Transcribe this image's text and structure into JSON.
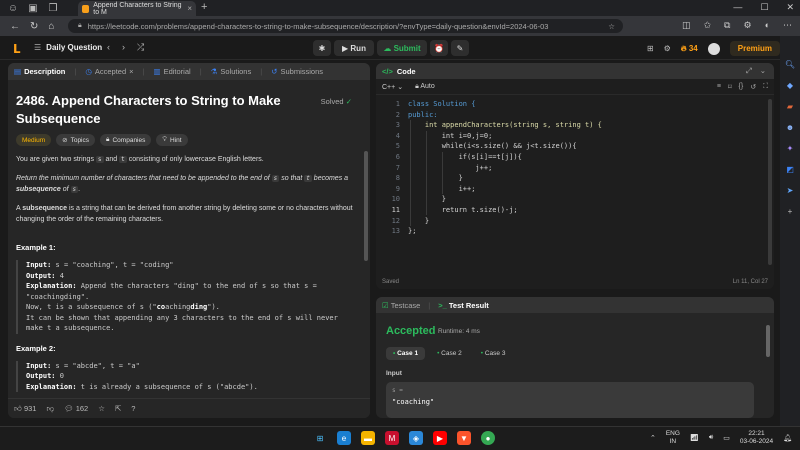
{
  "browser": {
    "tab_title": "Append Characters to String to M",
    "url": "https://leetcode.com/problems/append-characters-to-string-to-make-subsequence/description/?envType=daily-question&envId=2024-06-03"
  },
  "header": {
    "daily_question": "Daily Question",
    "run": "Run",
    "submit": "Submit",
    "streak": "34",
    "premium": "Premium"
  },
  "left": {
    "tabs": [
      {
        "label": "Description",
        "icon": "document-icon"
      },
      {
        "label": "Accepted",
        "icon": "clock-icon"
      },
      {
        "label": "Editorial",
        "icon": "book-icon"
      },
      {
        "label": "Solutions",
        "icon": "flask-icon"
      },
      {
        "label": "Submissions",
        "icon": "history-icon"
      }
    ],
    "title": "2486. Append Characters to String to Make Subsequence",
    "solved": "Solved",
    "tags": [
      "Medium",
      "Topics",
      "Companies",
      "Hint"
    ],
    "p1_a": "You are given two strings",
    "p1_s": "s",
    "p1_and": "and",
    "p1_t": "t",
    "p1_b": "consisting of only lowercase English letters.",
    "p2_a": "Return the minimum number of characters that need to be appended to the end of",
    "p2_s": "s",
    "p2_so": "so that",
    "p2_t": "t",
    "p2_b": "becomes a",
    "p2_c": "subsequence",
    "p2_of": "of",
    "p2_s2": "s",
    "p3_a": "A",
    "p3_b": "subsequence",
    "p3_c": "is a string that can be derived from another string by deleting some or no characters without changing the order of the remaining characters.",
    "ex1_title": "Example 1:",
    "ex1_input_lbl": "Input:",
    "ex1_input": "s = \"coaching\", t = \"coding\"",
    "ex1_output_lbl": "Output:",
    "ex1_output": "4",
    "ex1_expl_lbl": "Explanation:",
    "ex1_expl": "Append the characters \"ding\" to the end of s so that s = \"coachingding\".",
    "ex1_now_a": "Now, t is a subsequence of s (\"",
    "ex1_now_co": "co",
    "ex1_now_aching": "aching",
    "ex1_now_ding": "ding",
    "ex1_now_b": "\").",
    "ex1_more": "It can be shown that appending any 3 characters to the end of s will never make t a subsequence.",
    "ex2_title": "Example 2:",
    "ex2_input_lbl": "Input:",
    "ex2_input": "s = \"abcde\", t = \"a\"",
    "ex2_output_lbl": "Output:",
    "ex2_output": "0",
    "ex2_expl_lbl": "Explanation:",
    "ex2_expl": "t is already a subsequence of s (\"abcde\").",
    "likes": "931",
    "comments": "162"
  },
  "code": {
    "header": "Code",
    "language": "C++",
    "auto": "Auto",
    "lines": [
      "class Solution {",
      "public:",
      "    int appendCharacters(string s, string t) {",
      "        int i=0,j=0;",
      "        while(i<s.size() && j<t.size()){",
      "            if(s[i]==t[j]){",
      "                j++;",
      "            }",
      "            i++;",
      "        }",
      "        return t.size()-j;",
      "    }",
      "};"
    ],
    "line_numbers": [
      "1",
      "2",
      "3",
      "4",
      "5",
      "6",
      "7",
      "8",
      "9",
      "10",
      "11",
      "12",
      "13"
    ],
    "saved": "Saved",
    "cursor": "Ln 11, Col 27"
  },
  "test": {
    "tab_testcase": "Testcase",
    "tab_result": "Test Result",
    "status": "Accepted",
    "runtime": "Runtime: 4 ms",
    "cases": [
      "Case 1",
      "Case 2",
      "Case 3"
    ],
    "input_label": "Input",
    "var_name": "s =",
    "var_value": "\"coaching\""
  },
  "taskbar": {
    "lang1": "ENG",
    "lang2": "IN",
    "time": "22:21",
    "date": "03-06-2024"
  },
  "colors": {
    "accent": "#ffa116",
    "green": "#2cbb5d",
    "blue": "#3b82f6"
  }
}
